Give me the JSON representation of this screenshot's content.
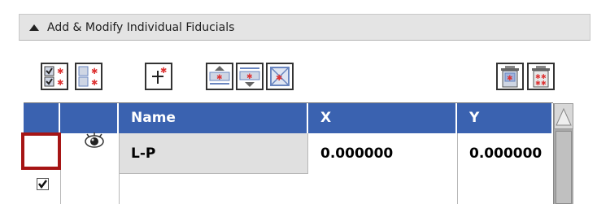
{
  "panel": {
    "title": "Add & Modify Individual Fiducials",
    "collapse_icon": "collapse-up-arrow-icon"
  },
  "toolbar": {
    "buttons": [
      {
        "name": "select-all-fiducials-icon"
      },
      {
        "name": "deselect-all-fiducials-icon"
      },
      {
        "name": "add-fiducial-icon"
      },
      {
        "name": "move-fiducial-up-icon"
      },
      {
        "name": "move-fiducial-down-icon"
      },
      {
        "name": "center-on-fiducial-icon"
      },
      {
        "name": "delete-selected-fiducials-icon"
      },
      {
        "name": "delete-all-fiducials-icon"
      }
    ]
  },
  "table": {
    "columns": [
      "",
      "",
      "Name",
      "X",
      "Y"
    ],
    "rows": [
      {
        "selected": true,
        "visible": true,
        "name": "L-P",
        "x": "0.000000",
        "y": "0.000000"
      }
    ]
  },
  "colors": {
    "header_bg": "#3a62b0",
    "highlight": "#a61515",
    "panel_header_bg": "#e4e4e4"
  }
}
